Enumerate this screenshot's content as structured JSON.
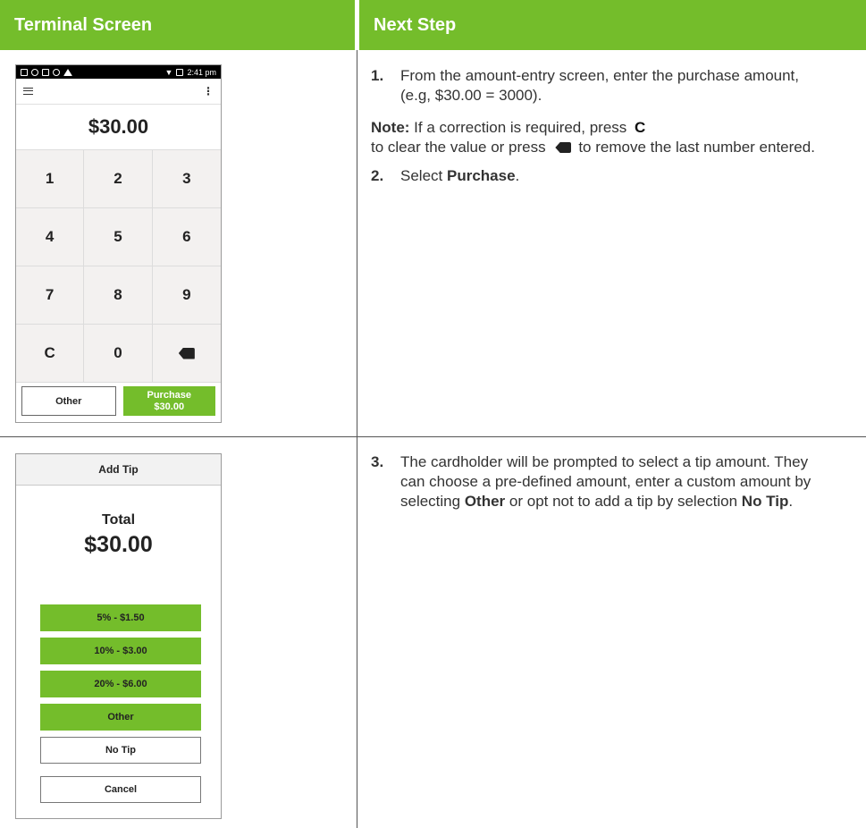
{
  "headers": {
    "left": "Terminal Screen",
    "right": "Next Step"
  },
  "terminal1": {
    "status_time": "2:41 pm",
    "amount": "$30.00",
    "keys": [
      "1",
      "2",
      "3",
      "4",
      "5",
      "6",
      "7",
      "8",
      "9",
      "C",
      "0"
    ],
    "other_label": "Other",
    "purchase_label": "Purchase",
    "purchase_amount": "$30.00"
  },
  "terminal2": {
    "title": "Add Tip",
    "total_label": "Total",
    "total_amount": "$30.00",
    "tip_options": [
      "5% - $1.50",
      "10% - $3.00",
      "20% - $6.00",
      "Other"
    ],
    "no_tip_label": "No Tip",
    "cancel_label": "Cancel"
  },
  "steps": {
    "step1_num": "1.",
    "step1_text": "From the amount-entry screen, enter the purchase amount, (e.g, $30.00 = 3000).",
    "note_label": "Note:",
    "note_text_a": " If a correction is required, press ",
    "note_key": "C",
    "note_text_b": "to clear the value or press ",
    "note_text_c": "to remove the last number entered.",
    "step2_num": "2.",
    "step2_pre": "Select ",
    "step2_bold": "Purchase",
    "step2_post": ".",
    "step3_num": "3.",
    "step3_text_a": "The cardholder will be prompted to select a tip amount. They can choose a pre-defined amount, enter a custom amount by selecting ",
    "step3_bold1": "Other",
    "step3_text_b": " or opt not to add a tip by selection ",
    "step3_bold2": "No Tip",
    "step3_text_c": "."
  },
  "colors": {
    "accent": "#74bd2b"
  }
}
